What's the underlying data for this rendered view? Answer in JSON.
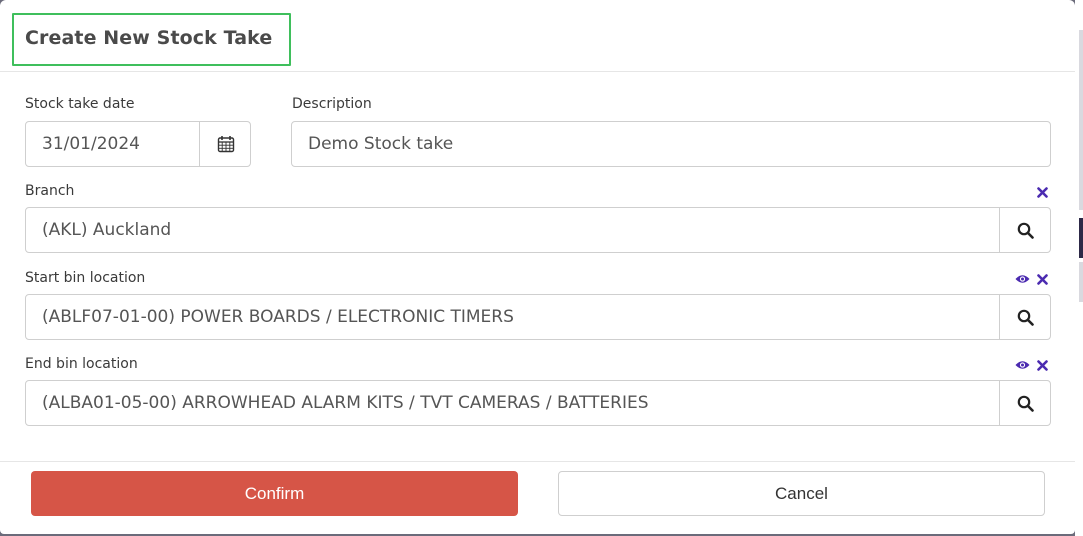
{
  "dialog": {
    "title": "Create New Stock Take"
  },
  "form": {
    "stock_take_date": {
      "label": "Stock take date",
      "value": "31/01/2024",
      "addon_icon": "calendar-icon"
    },
    "description": {
      "label": "Description",
      "value": "Demo Stock take"
    },
    "branch": {
      "label": "Branch",
      "value": "(AKL) Auckland",
      "actions": [
        "clear-icon"
      ],
      "addon_icon": "search-icon"
    },
    "start_bin": {
      "label": "Start bin location",
      "value": "(ABLF07-01-00) POWER BOARDS /  ELECTRONIC TIMERS",
      "actions": [
        "view-icon",
        "clear-icon"
      ],
      "addon_icon": "search-icon"
    },
    "end_bin": {
      "label": "End bin location",
      "value": "(ALBA01-05-00) ARROWHEAD ALARM KITS / TVT CAMERAS / BATTERIES",
      "actions": [
        "view-icon",
        "clear-icon"
      ],
      "addon_icon": "search-icon"
    }
  },
  "buttons": {
    "confirm_label": "Confirm",
    "cancel_label": "Cancel"
  },
  "colors": {
    "confirm_bg": "#d65547",
    "action_icon": "#4b2bb0",
    "title_highlight": "#3fbf5c"
  }
}
